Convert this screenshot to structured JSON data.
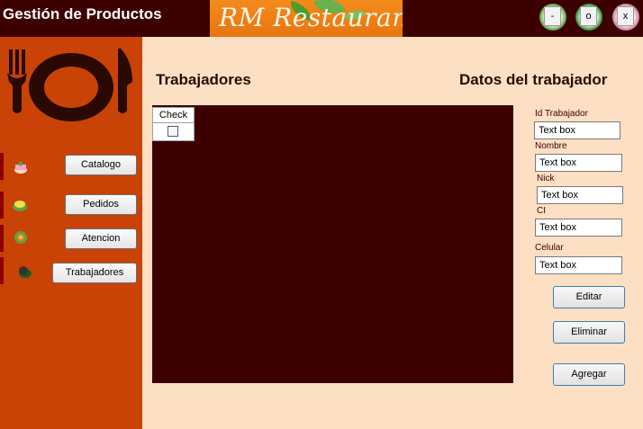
{
  "window": {
    "title": "Gestión de Productos",
    "brand": "RM Restaurant",
    "minimize_label": "-",
    "maximize_label": "o",
    "close_label": "x"
  },
  "sidebar": {
    "items": [
      {
        "label": "Catalogo",
        "icon": "cake-icon"
      },
      {
        "label": "Pedidos",
        "icon": "food-plate-icon"
      },
      {
        "label": "Atencion",
        "icon": "salad-icon"
      },
      {
        "label": "Trabajadores",
        "icon": "worker-icon"
      }
    ]
  },
  "main": {
    "list_title": "Trabajadores",
    "details_title": "Datos del trabajador",
    "grid": {
      "columns": [
        "Check"
      ],
      "rows": [
        {
          "check": false
        }
      ]
    },
    "fields": [
      {
        "label": "Id Trabajador",
        "value": "Text box"
      },
      {
        "label": "Nombre",
        "value": "Text box"
      },
      {
        "label": "Nick",
        "value": "Text box"
      },
      {
        "label": "CI",
        "value": "Text box"
      },
      {
        "label": "Celular",
        "value": "Text box"
      }
    ],
    "buttons": {
      "edit": "Editar",
      "delete": "Eliminar",
      "add": "Agregar"
    }
  },
  "colors": {
    "titlebar": "#3d0000",
    "sidebar": "#c94206",
    "content": "#fde0c4",
    "grid": "#3d0000",
    "brand": "#f38b1b"
  }
}
